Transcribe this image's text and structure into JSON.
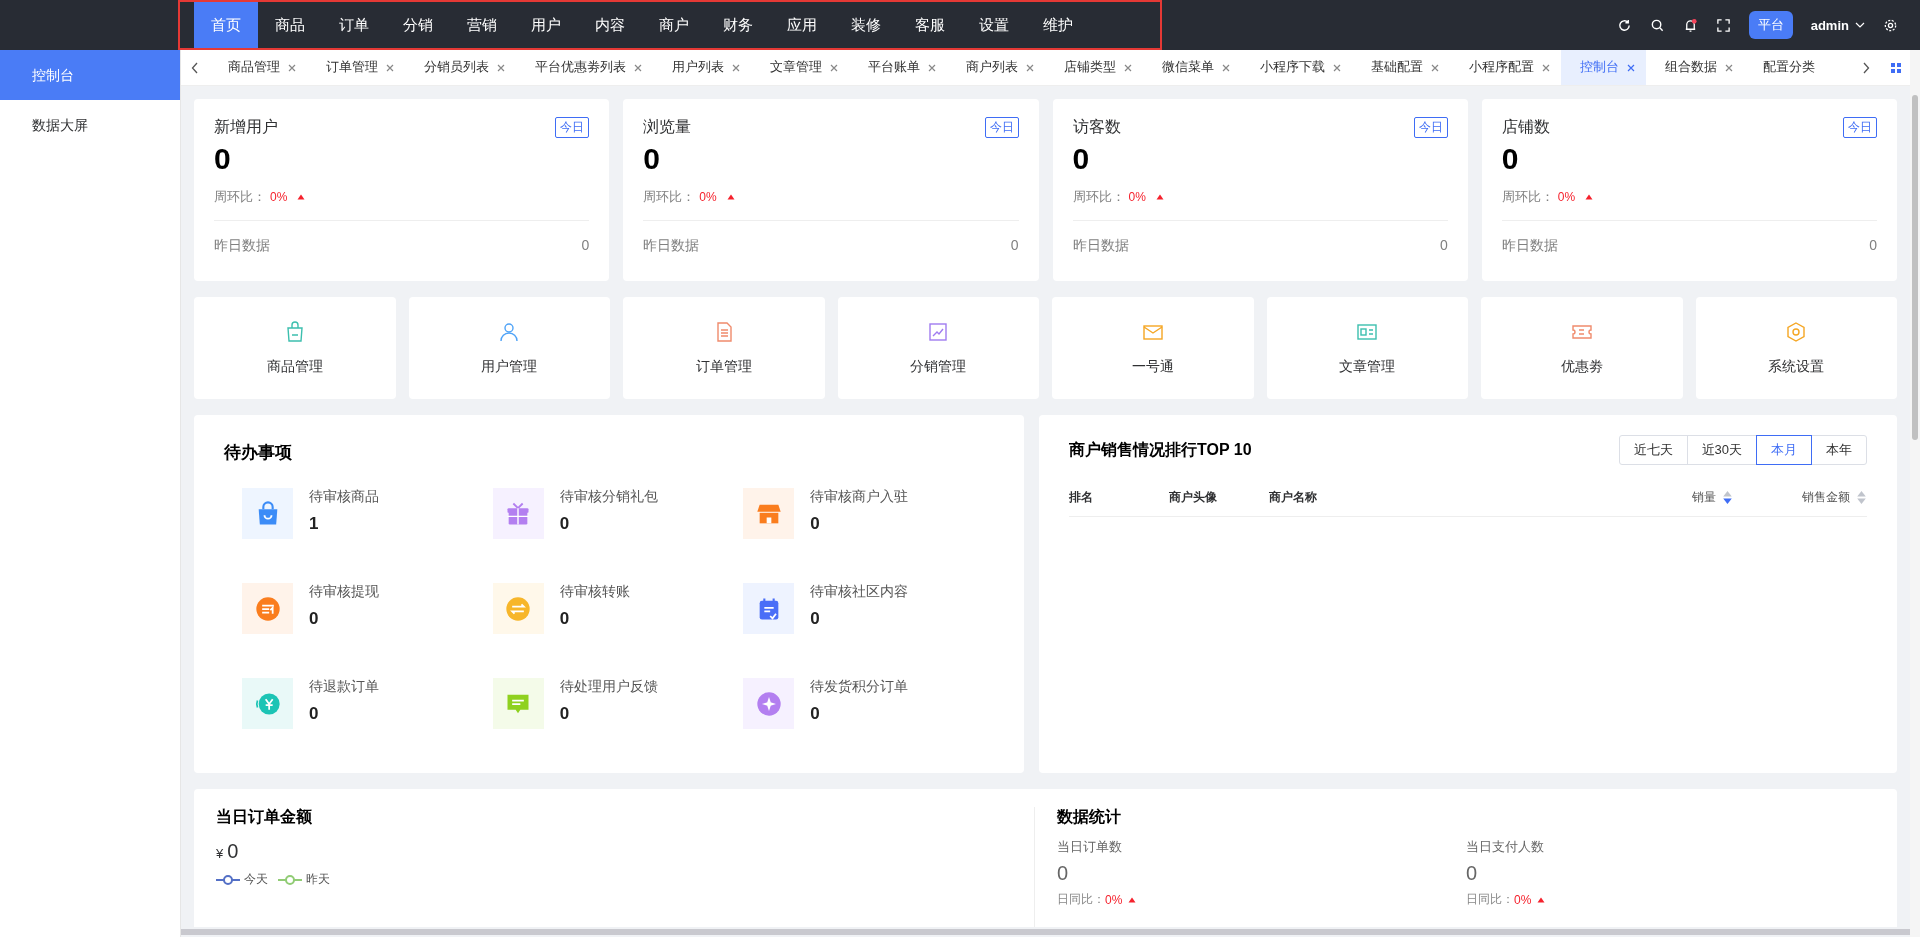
{
  "nav": [
    {
      "label": "首页",
      "selected": true
    },
    {
      "label": "商品",
      "selected": false
    },
    {
      "label": "订单",
      "selected": false
    },
    {
      "label": "分销",
      "selected": false
    },
    {
      "label": "营销",
      "selected": false
    },
    {
      "label": "用户",
      "selected": false
    },
    {
      "label": "内容",
      "selected": false
    },
    {
      "label": "商户",
      "selected": false
    },
    {
      "label": "财务",
      "selected": false
    },
    {
      "label": "应用",
      "selected": false
    },
    {
      "label": "装修",
      "selected": false
    },
    {
      "label": "客服",
      "selected": false
    },
    {
      "label": "设置",
      "selected": false
    },
    {
      "label": "维护",
      "selected": false
    }
  ],
  "header": {
    "platform": "平台",
    "user": "admin",
    "notification": true
  },
  "sidebar": {
    "items": [
      {
        "label": "控制台",
        "selected": true
      },
      {
        "label": "数据大屏",
        "selected": false
      }
    ]
  },
  "tabs": [
    {
      "label": "商品管理",
      "selected": false,
      "closable": true
    },
    {
      "label": "订单管理",
      "selected": false,
      "closable": true
    },
    {
      "label": "分销员列表",
      "selected": false,
      "closable": true
    },
    {
      "label": "平台优惠劵列表",
      "selected": false,
      "closable": true
    },
    {
      "label": "用户列表",
      "selected": false,
      "closable": true
    },
    {
      "label": "文章管理",
      "selected": false,
      "closable": true
    },
    {
      "label": "平台账单",
      "selected": false,
      "closable": true
    },
    {
      "label": "商户列表",
      "selected": false,
      "closable": true
    },
    {
      "label": "店铺类型",
      "selected": false,
      "closable": true
    },
    {
      "label": "微信菜单",
      "selected": false,
      "closable": true
    },
    {
      "label": "小程序下载",
      "selected": false,
      "closable": true
    },
    {
      "label": "基础配置",
      "selected": false,
      "closable": true
    },
    {
      "label": "小程序配置",
      "selected": false,
      "closable": true
    },
    {
      "label": "控制台",
      "selected": true,
      "closable": true
    },
    {
      "label": "组合数据",
      "selected": false,
      "closable": true
    },
    {
      "label": "配置分类",
      "selected": false,
      "closable": false
    }
  ],
  "stats": [
    {
      "title": "新增用户",
      "badge": "今日",
      "value": "0",
      "ratio_label": "周环比：",
      "ratio": "0%",
      "trend_up": true,
      "yesterday_label": "昨日数据",
      "yesterday": "0"
    },
    {
      "title": "浏览量",
      "badge": "今日",
      "value": "0",
      "ratio_label": "周环比：",
      "ratio": "0%",
      "trend_up": true,
      "yesterday_label": "昨日数据",
      "yesterday": "0"
    },
    {
      "title": "访客数",
      "badge": "今日",
      "value": "0",
      "ratio_label": "周环比：",
      "ratio": "0%",
      "trend_up": true,
      "yesterday_label": "昨日数据",
      "yesterday": "0"
    },
    {
      "title": "店铺数",
      "badge": "今日",
      "value": "0",
      "ratio_label": "周环比：",
      "ratio": "0%",
      "trend_up": true,
      "yesterday_label": "昨日数据",
      "yesterday": "0"
    }
  ],
  "shortcuts": [
    {
      "label": "商品管理",
      "kind": "bag"
    },
    {
      "label": "用户管理",
      "kind": "user"
    },
    {
      "label": "订单管理",
      "kind": "document"
    },
    {
      "label": "分销管理",
      "kind": "chart"
    },
    {
      "label": "一号通",
      "kind": "mail"
    },
    {
      "label": "文章管理",
      "kind": "article"
    },
    {
      "label": "优惠劵",
      "kind": "ticket"
    },
    {
      "label": "系统设置",
      "kind": "settings"
    }
  ],
  "todo": {
    "title": "待办事项",
    "items": [
      {
        "label": "待审核商品",
        "count": "1",
        "kind": "bag"
      },
      {
        "label": "待审核分销礼包",
        "count": "0",
        "kind": "gift"
      },
      {
        "label": "待审核商户入驻",
        "count": "0",
        "kind": "store"
      },
      {
        "label": "待审核提现",
        "count": "0",
        "kind": "withdraw"
      },
      {
        "label": "待审核转账",
        "count": "0",
        "kind": "transfer"
      },
      {
        "label": "待审核社区内容",
        "count": "0",
        "kind": "calendar"
      },
      {
        "label": "待退款订单",
        "count": "0",
        "kind": "refund"
      },
      {
        "label": "待处理用户反馈",
        "count": "0",
        "kind": "feedback"
      },
      {
        "label": "待发货积分订单",
        "count": "0",
        "kind": "points"
      }
    ]
  },
  "ranking": {
    "title": "商户销售情况排行TOP 10",
    "ranges": [
      {
        "label": "近七天",
        "selected": false
      },
      {
        "label": "近30天",
        "selected": false
      },
      {
        "label": "本月",
        "selected": true
      },
      {
        "label": "本年",
        "selected": false
      }
    ],
    "columns": [
      {
        "label": "排名"
      },
      {
        "label": "商户头像"
      },
      {
        "label": "商户名称"
      },
      {
        "label": "销量",
        "sorted": true
      },
      {
        "label": "销售金额",
        "sorted": false
      }
    ]
  },
  "daily_amount": {
    "title": "当日订单金额",
    "currency": "¥",
    "value": "0",
    "legend": [
      {
        "name": "今天",
        "color": "#5470c6"
      },
      {
        "name": "昨天",
        "color": "#91cc75"
      }
    ]
  },
  "data_stats": {
    "title": "数据统计",
    "items": [
      {
        "label": "当日订单数",
        "value": "0",
        "ratio_label": "日同比：",
        "ratio": "0%"
      },
      {
        "label": "当日支付人数",
        "value": "0",
        "ratio_label": "日同比：",
        "ratio": "0%"
      }
    ]
  }
}
